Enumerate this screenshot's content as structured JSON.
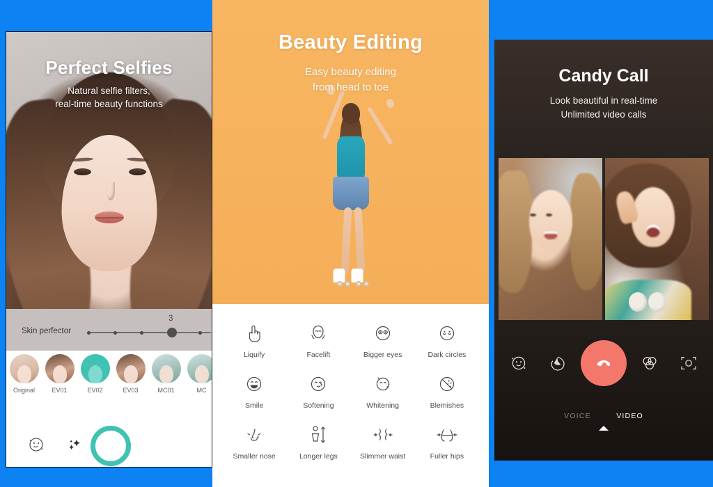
{
  "theme": {
    "background_blue": "#0d82f2",
    "panel2_orange": "#f7b35f",
    "accent_teal": "#3fc2b2",
    "endcall_red": "#f4776c",
    "panel3_dark": "#2b2421"
  },
  "panel1": {
    "name": "Perfect Selfies",
    "title": "Perfect Selfies",
    "subtitle_line1": "Natural selfie filters,",
    "subtitle_line2": "real-time beauty functions",
    "slider": {
      "label": "Skin perfector",
      "value": "3",
      "steps": 5,
      "active_step": 4
    },
    "filters": [
      {
        "label": "Original",
        "selected": false,
        "style": "orig"
      },
      {
        "label": "EV01",
        "selected": false,
        "style": ""
      },
      {
        "label": "EV02",
        "selected": true,
        "style": "sel"
      },
      {
        "label": "EV03",
        "selected": false,
        "style": ""
      },
      {
        "label": "MC01",
        "selected": false,
        "style": "mc"
      },
      {
        "label": "MC",
        "selected": false,
        "style": "mc"
      }
    ],
    "camera_bar": {
      "beauty_icon": "smiley-face-icon",
      "effects_icon": "sparkles-icon",
      "shutter": "shutter-button"
    }
  },
  "panel2": {
    "name": "Beauty Editing",
    "title": "Beauty Editing",
    "subtitle_line1": "Easy beauty editing",
    "subtitle_line2": "from head to toe",
    "tools": [
      {
        "label": "Liquify",
        "icon": "pointing-hand-icon"
      },
      {
        "label": "Facelift",
        "icon": "face-slim-icon"
      },
      {
        "label": "Bigger eyes",
        "icon": "big-eyes-face-icon"
      },
      {
        "label": "Dark circles",
        "icon": "dark-circles-face-icon"
      },
      {
        "label": "Smile",
        "icon": "smiling-face-icon"
      },
      {
        "label": "Softening",
        "icon": "softening-face-icon"
      },
      {
        "label": "Whitening",
        "icon": "whitening-face-icon"
      },
      {
        "label": "Blemishes",
        "icon": "blemishes-icon"
      },
      {
        "label": "Smaller nose",
        "icon": "nose-icon"
      },
      {
        "label": "Longer legs",
        "icon": "body-height-icon"
      },
      {
        "label": "Slimmer waist",
        "icon": "waist-icon"
      },
      {
        "label": "Fuller hips",
        "icon": "hips-icon"
      }
    ]
  },
  "panel3": {
    "name": "Candy Call",
    "title": "Candy Call",
    "subtitle_line1": "Look beautiful in real-time",
    "subtitle_line2": "Unlimited video calls",
    "controls": [
      {
        "icon": "beauty-smiley-icon"
      },
      {
        "icon": "filter-droplet-icon"
      },
      {
        "icon": "end-call-icon"
      },
      {
        "icon": "color-filters-icon"
      },
      {
        "icon": "switch-camera-icon"
      }
    ],
    "tabs": [
      {
        "label": "VOICE",
        "active": false
      },
      {
        "label": "VIDEO",
        "active": true
      }
    ]
  }
}
